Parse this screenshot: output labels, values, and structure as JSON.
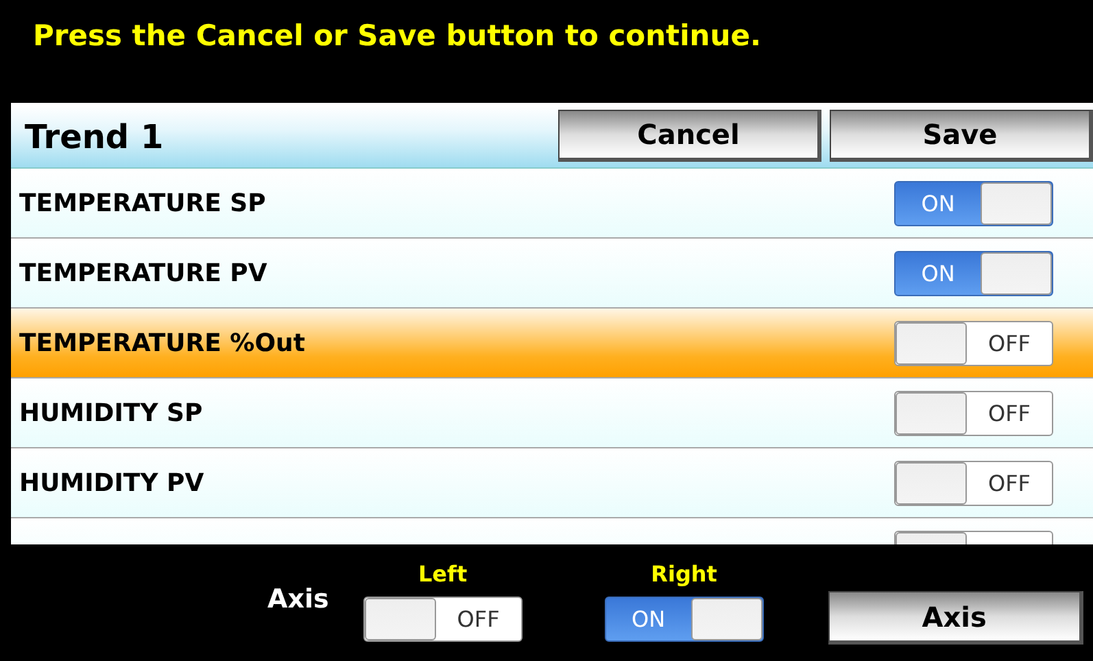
{
  "message": "Press the Cancel or Save button to continue.",
  "header": {
    "title": "Trend 1",
    "buttons": [
      "Cancel",
      "Save"
    ]
  },
  "rows": [
    {
      "label": "TEMPERATURE SP",
      "selected": false,
      "on": true,
      "state_text": "ON"
    },
    {
      "label": "TEMPERATURE PV",
      "selected": false,
      "on": true,
      "state_text": "ON"
    },
    {
      "label": "TEMPERATURE %Out",
      "selected": true,
      "on": false,
      "state_text": "OFF"
    },
    {
      "label": "HUMIDITY SP",
      "selected": false,
      "on": false,
      "state_text": "OFF"
    },
    {
      "label": "HUMIDITY PV",
      "selected": false,
      "on": false,
      "state_text": "OFF"
    },
    {
      "selected": false,
      "on": false
    }
  ],
  "footer": {
    "axis_label": "Axis",
    "switches": [
      {
        "label": "Left",
        "on": false,
        "state_text": "OFF"
      },
      {
        "label": "Right",
        "on": true,
        "state_text": "ON"
      }
    ],
    "button": "Axis"
  }
}
